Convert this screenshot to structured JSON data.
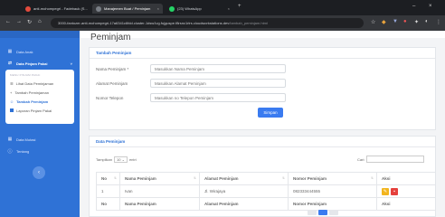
{
  "browser": {
    "tabs": [
      {
        "label": "anti-mohompegri - Fadebauk (S...",
        "fav": "#e34b3d"
      },
      {
        "label": "Manajemen Buat / Peminjam",
        "fav": "#7a7f86"
      },
      {
        "label": "(23) WhatsApp",
        "fav": "#25d366"
      }
    ],
    "url_main": "3000-fantozer-anti-mohompegri-17a6341c6fdd.cluster-1dsw1vg.fujguspe.f8rsnc1rlrs.cloudworkstations.dev",
    "url_path": "/tambah_peminjam.html"
  },
  "sidebar": {
    "items": [
      {
        "label": "Data Anak",
        "icon": "grid-icon"
      },
      {
        "label": "Data Pinjam Pakai",
        "icon": "share-icon"
      },
      {
        "label": "Data Mutasi",
        "icon": "grid-icon"
      },
      {
        "label": "Tentang",
        "icon": "info-icon"
      }
    ],
    "submenu_header": "MENU PINJAM PAKAI",
    "submenu": [
      {
        "label": "Lihat Data Peminjaman",
        "icon": "list-icon"
      },
      {
        "label": "Tambah Peminjaman",
        "icon": "plus-icon"
      },
      {
        "label": "Tambah Peminjam",
        "icon": "user-plus-icon"
      },
      {
        "label": "Laporan Pinjam Pakai",
        "icon": "report-icon"
      }
    ]
  },
  "page": {
    "title": "Peminjam",
    "form_card_title": "Tambah Peminjam",
    "form": [
      {
        "label": "Nama Peminjam *",
        "placeholder": "Masukkan Nama Peminjam"
      },
      {
        "label": "Alamat Peminjam",
        "placeholder": "Masukkan Alamat Peminjam"
      },
      {
        "label": "Nomor Telepon",
        "placeholder": "Masukkan no Telepon Peminjam"
      }
    ],
    "save_label": "Simpan",
    "table_card_title": "Data Peminjam",
    "show_label": "Tampilkan",
    "show_value": "10",
    "entries_label": "entri",
    "search_label": "Cari:",
    "columns": [
      "No",
      "Nama Peminjam",
      "Alamat Peminjam",
      "Nomor Peminjam",
      "Aksi"
    ],
    "rows": [
      {
        "no": "1",
        "nama": "Ivan",
        "alamat": "Jl. Wirajaya",
        "nomor": "082333444555"
      }
    ],
    "footer": [
      "No",
      "Nama Peminjam",
      "Alamat Peminjam",
      "Nomor Peminjam",
      "Aksi"
    ]
  },
  "colors": {
    "accent": "#2f72d6",
    "edit": "#f2b51f",
    "delete": "#e5413d",
    "button": "#3a7bf0"
  }
}
